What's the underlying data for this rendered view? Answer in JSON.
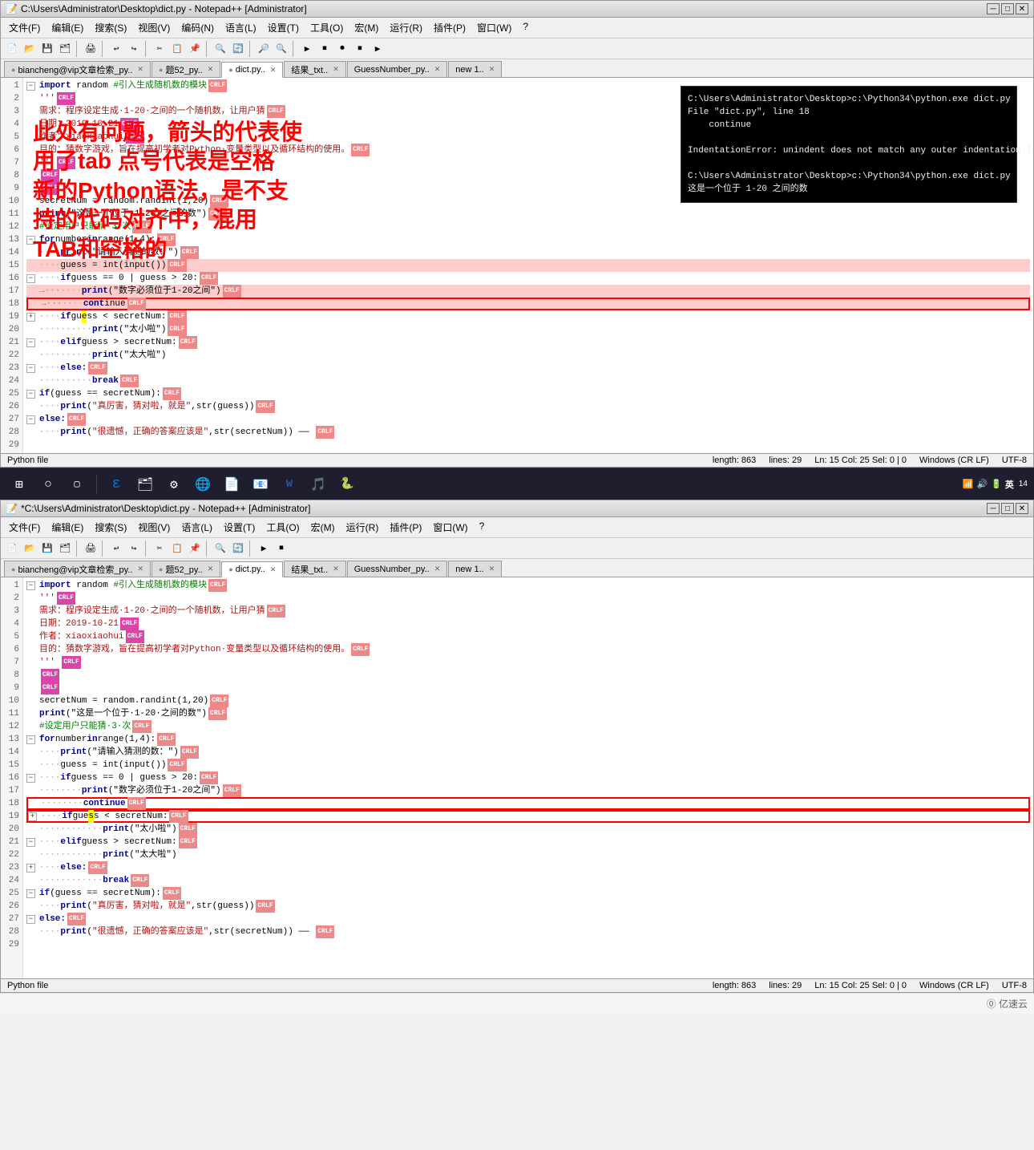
{
  "window1": {
    "title": "C:\\Users\\Administrator\\Desktop\\dict.py - Notepad++ [Administrator]",
    "menus": [
      "文件(F)",
      "编辑(E)",
      "搜索(S)",
      "视图(V)",
      "编码(N)",
      "语言(L)",
      "设置(T)",
      "工具(O)",
      "宏(M)",
      "运行(R)",
      "插件(P)",
      "窗口(W)",
      "?"
    ],
    "tabs": [
      {
        "label": "biancheng@vip文章检索_py..",
        "active": false
      },
      {
        "label": "题52_py..",
        "active": false
      },
      {
        "label": "dict.py..",
        "active": true
      },
      {
        "label": "结果_txt..",
        "active": false
      },
      {
        "label": "GuessNumber_py..",
        "active": false
      },
      {
        "label": "new 1..",
        "active": false
      }
    ],
    "status": {
      "file_type": "Python file",
      "length": "length: 863",
      "lines": "lines: 29",
      "cursor": "Ln: 15   Col: 25   Sel: 0 | 0",
      "line_ending": "Windows (CR LF)",
      "encoding": "UTF-8"
    },
    "error_popup": {
      "lines": [
        "C:\\Users\\Administrator\\Desktop>c:\\Python34\\python.exe dict.py",
        "File \"dict.py\", line 18",
        "    continue",
        "",
        "IndentationError: unindent does not match any outer indentation level",
        "",
        "C:\\Users\\Administrator\\Desktop>c:\\Python34\\python.exe dict.py",
        "这是一个位于 1-20 之间的数"
      ]
    },
    "annotation": {
      "line1": "此处有问题，箭头的代表使",
      "line2": "用了tab 点号代表是空格",
      "line3": "新的Python语法，是不支",
      "line4": "持的代码对齐中，混用",
      "line5": "TAB和空格的"
    }
  },
  "window2": {
    "title": "*C:\\Users\\Administrator\\Desktop\\dict.py - Notepad++ [Administrator]",
    "menus": [
      "文件(F)",
      "编辑(E)",
      "搜索(S)",
      "视图(V)",
      "语言(L)",
      "设置(T)",
      "工具(O)",
      "宏(M)",
      "运行(R)",
      "插件(P)",
      "窗口(W)",
      "?"
    ],
    "tabs": [
      {
        "label": "biancheng@vip文章检索_py..",
        "active": false
      },
      {
        "label": "题52_py..",
        "active": false
      },
      {
        "label": "dict.py..",
        "active": true
      },
      {
        "label": "结果_txt..",
        "active": false
      },
      {
        "label": "GuessNumber_py..",
        "active": false
      },
      {
        "label": "new 1..",
        "active": false
      }
    ],
    "status": {
      "file_type": "Python file",
      "length": "length: 863",
      "lines": "lines: 29",
      "cursor": "Ln: 15   Col: 25   Sel: 0 | 0",
      "line_ending": "Windows (CR LF)",
      "encoding": "UTF-8"
    }
  },
  "taskbar": {
    "time": "14",
    "items": [
      "⊞",
      "○",
      "▢",
      "🔍",
      "🗂",
      "⚙",
      "🌐",
      "📄",
      "📧",
      "W",
      "📋",
      "🎵",
      "🔵"
    ]
  },
  "branding": "⓪ 亿速云"
}
